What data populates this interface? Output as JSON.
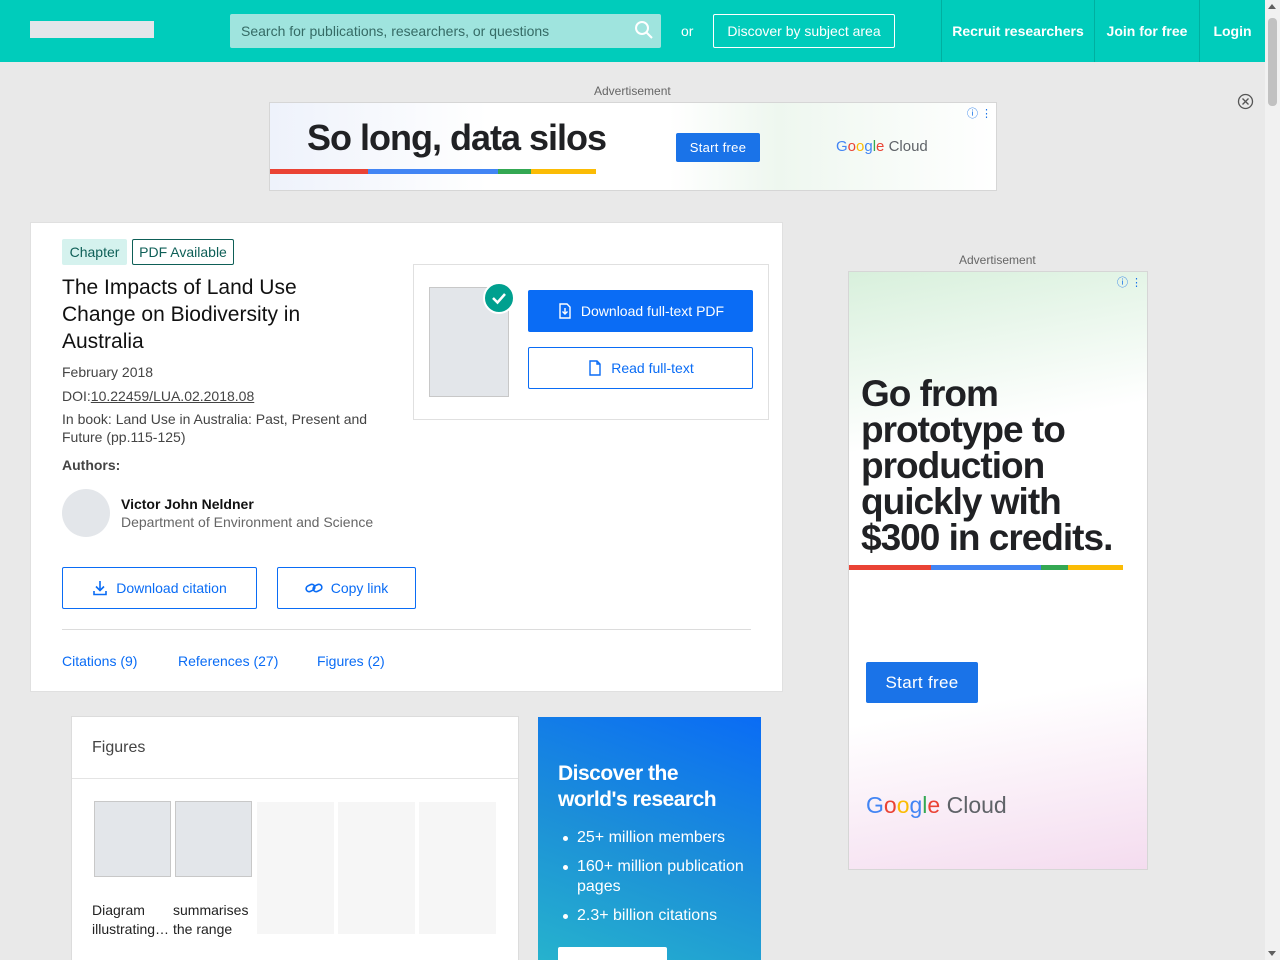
{
  "header": {
    "search_placeholder": "Search for publications, researchers, or questions",
    "or_label": "or",
    "discover_label": "Discover by subject area",
    "recruit_label": "Recruit researchers",
    "join_label": "Join for free",
    "login_label": "Login"
  },
  "ads": {
    "label": "Advertisement",
    "top": {
      "headline": "So long, data silos",
      "cta": "Start free",
      "brand": "Google Cloud"
    },
    "side": {
      "headline": "Go from prototype to production quickly with $300 in credits.",
      "cta": "Start free",
      "brand": "Google Cloud"
    },
    "rainbow_colors": [
      "#ea4335",
      "#4285f4",
      "#34a853",
      "#fbbc05"
    ]
  },
  "publication": {
    "type_badge": "Chapter",
    "pdf_badge": "PDF Available",
    "title": "The Impacts of Land Use Change on Biodiversity in Australia",
    "date": "February 2018",
    "doi_prefix": "DOI:",
    "doi": "10.22459/LUA.02.2018.08",
    "book": "In book: Land Use in Australia: Past, Present and Future (pp.115-125)",
    "authors_label": "Authors:",
    "authors": [
      {
        "name": "Victor John Neldner",
        "affiliation": "Department of Environment and Science"
      }
    ]
  },
  "actions": {
    "download_pdf": "Download full-text PDF",
    "read_fulltext": "Read full-text",
    "download_citation": "Download citation",
    "copy_link": "Copy link"
  },
  "tabs": [
    {
      "label": "Citations (9)"
    },
    {
      "label": "References (27)"
    },
    {
      "label": "Figures (2)"
    }
  ],
  "figures": {
    "title": "Figures",
    "items": [
      {
        "caption": "Diagram illustrating…"
      },
      {
        "caption": "summarises the range o…"
      }
    ]
  },
  "promo": {
    "title": "Discover the world's research",
    "items": [
      "25+ million members",
      "160+ million publication pages",
      "2.3+ billion citations"
    ]
  },
  "colors": {
    "brand_teal": "#00ccbb",
    "primary_blue": "#0a6cf5",
    "check_green": "#00a08f"
  }
}
